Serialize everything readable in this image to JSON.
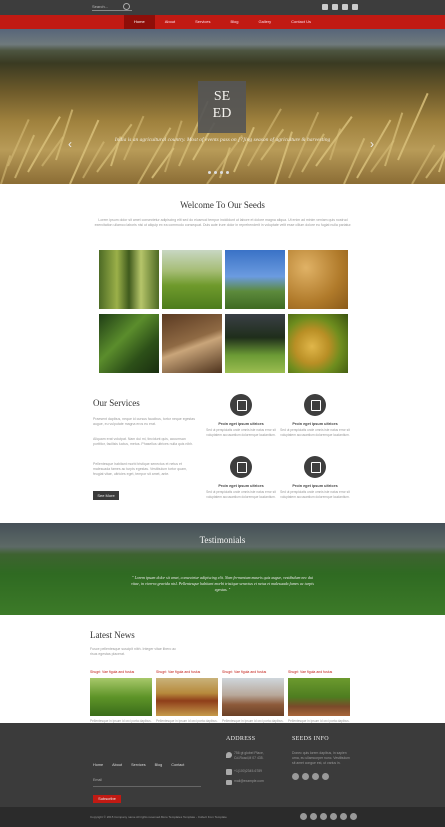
{
  "search": {
    "placeholder": "Search..."
  },
  "social": [
    "facebook-icon",
    "twitter-icon",
    "rss-icon",
    "google-plus-icon"
  ],
  "nav": {
    "items": [
      "Home",
      "About",
      "Services",
      "Blog",
      "Gallery",
      "Contact Us"
    ],
    "active": "Home"
  },
  "hero": {
    "logo_line1": "SE",
    "logo_line2": "ED",
    "caption": "India is an agricultural country. Most of events pass on [?]ing season of agriculture & harvesting",
    "prev_arrow": "‹",
    "next_arrow": "›"
  },
  "welcome": {
    "title": "Welcome To Our Seeds",
    "text": "Lorem ipsum dolor sit amet consectetur adipiscing elit sed do eiusmod tempor incididunt ut labore et dolore magna aliqua. Ut enim ad minim veniam quis nostrud exercitation ullamco laboris nisi ut aliquip ex ea commodo consequat. Duis aute irure dolor in reprehenderit in voluptate velit esse cillum dolore eu fugiat nulla pariatur."
  },
  "services": {
    "title": "Our Services",
    "intro": "Praesent dapibus, neque id cursus faucibus, tortor neque egestas augue, eu vulputate magna eros eu erat.",
    "body1": "Aliquam erat volutpat. Nam dui mi, tincidunt quis, accumsan porttitor, facilisis luctus, metus. Phasellus ultrices nulla quis nibh.",
    "body2": "Pellentesque habitant morbi tristique senectus et netus et malesuada fames ac turpis egestas. Vestibulum tortor quam, feugiat vitae, ultricies eget, tempor sit amet, ante.",
    "button": "See More",
    "items": [
      {
        "title": "Proin eget ipsum ultrices",
        "text": "Sed ut perspiciatis unde omnis iste natus error sit voluptatem accusantium doloremque laudantium."
      },
      {
        "title": "Proin eget ipsum ultrices",
        "text": "Sed ut perspiciatis unde omnis iste natus error sit voluptatem accusantium doloremque laudantium."
      },
      {
        "title": "Proin eget ipsum ultrices",
        "text": "Sed ut perspiciatis unde omnis iste natus error sit voluptatem accusantium doloremque laudantium."
      },
      {
        "title": "Proin eget ipsum ultrices",
        "text": "Sed ut perspiciatis unde omnis iste natus error sit voluptatem accusantium doloremque laudantium."
      }
    ]
  },
  "testimonials": {
    "title": "Testimonials",
    "quote": "\" Lorem ipsum dolor sit amet, consectetur adipiscing elit. Nam fermentum mauris quis augue, vestibulum nec dui vitae, in viverra gravida nisl. Pellentesque habitant morbi tristique senectus et netus et malesuada fames ac turpis egestas. \""
  },
  "news": {
    "title": "Latest News",
    "intro": "Fusce pellentesque suscipit nibh. Integer vitae libero ac risus egestas placerat.",
    "items": [
      {
        "title": "Shugri: Vae figula and fuslus",
        "text": "Pellentesque in ipsum id orci porta dapibus. Nulla quis lorem ut libero malesuada feugiat."
      },
      {
        "title": "Shugri: Vae figula and fuslus",
        "text": "Pellentesque in ipsum id orci porta dapibus. Nulla quis lorem ut libero malesuada feugiat."
      },
      {
        "title": "Shugri: Vae figula and fuslus",
        "text": "Pellentesque in ipsum id orci porta dapibus. Nulla quis lorem ut libero malesuada feugiat."
      },
      {
        "title": "Shugri: Vae figula and fuslus",
        "text": "Pellentesque in ipsum id orci porta dapibus. Nulla quis lorem ut libero malesuada feugiat."
      }
    ]
  },
  "footer": {
    "nav": [
      "Home",
      "About",
      "Services",
      "Blog",
      "Contact"
    ],
    "email_placeholder": "Email",
    "subscribe": "Subscribe",
    "address_title": "ADDRESS",
    "address_line1": "756 gt globel Place,",
    "address_line2": "Cd-Road,M 07 435.",
    "phone": "+1(100)2345-6789",
    "email": "mail@example.com",
    "info_title": "SEEDS INFO",
    "info_text": "Donec quis lorem dapibus, in sapien urna, eu ullamcorper nunc. Vestibulum sit amet congue est, ut varius in.",
    "copyright": "Copyright © 2015 Company name All rights reserved.More Templates Template - Collect from Template"
  },
  "colors": {
    "accent": "#c11a13",
    "dark": "#3b3b3b"
  }
}
